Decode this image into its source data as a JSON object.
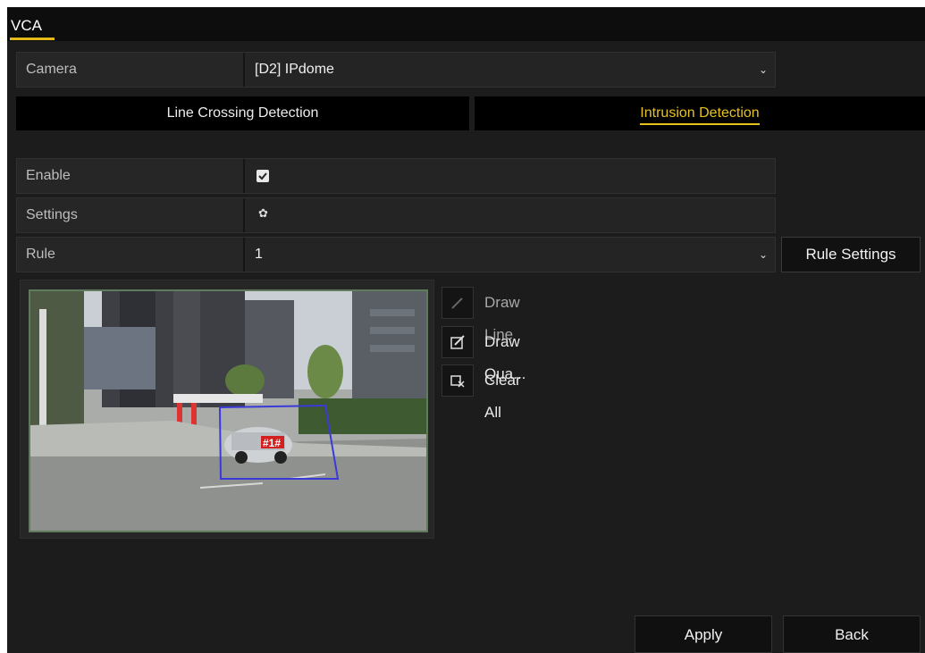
{
  "window": {
    "title": "VCA"
  },
  "camera": {
    "label": "Camera",
    "value": "[D2] IPdome"
  },
  "tabs": [
    {
      "label": "Line Crossing Detection",
      "active": false
    },
    {
      "label": "Intrusion Detection",
      "active": true
    }
  ],
  "enable": {
    "label": "Enable",
    "checked": true
  },
  "settings": {
    "label": "Settings",
    "icon": "gear-icon"
  },
  "rule": {
    "label": "Rule",
    "value": "1",
    "settings_button": "Rule Settings"
  },
  "preview": {
    "region_label": "#1#",
    "region_color": "#3a3ad8"
  },
  "tools": [
    {
      "label": "Draw Line",
      "icon": "pencil-icon",
      "enabled": false
    },
    {
      "label": "Draw Qua...",
      "icon": "edit-icon",
      "enabled": true
    },
    {
      "label": "Clear All",
      "icon": "clear-icon",
      "enabled": true
    }
  ],
  "footer": {
    "apply": "Apply",
    "back": "Back"
  },
  "colors": {
    "accent": "#e6c21f",
    "background": "#1c1c1c"
  }
}
